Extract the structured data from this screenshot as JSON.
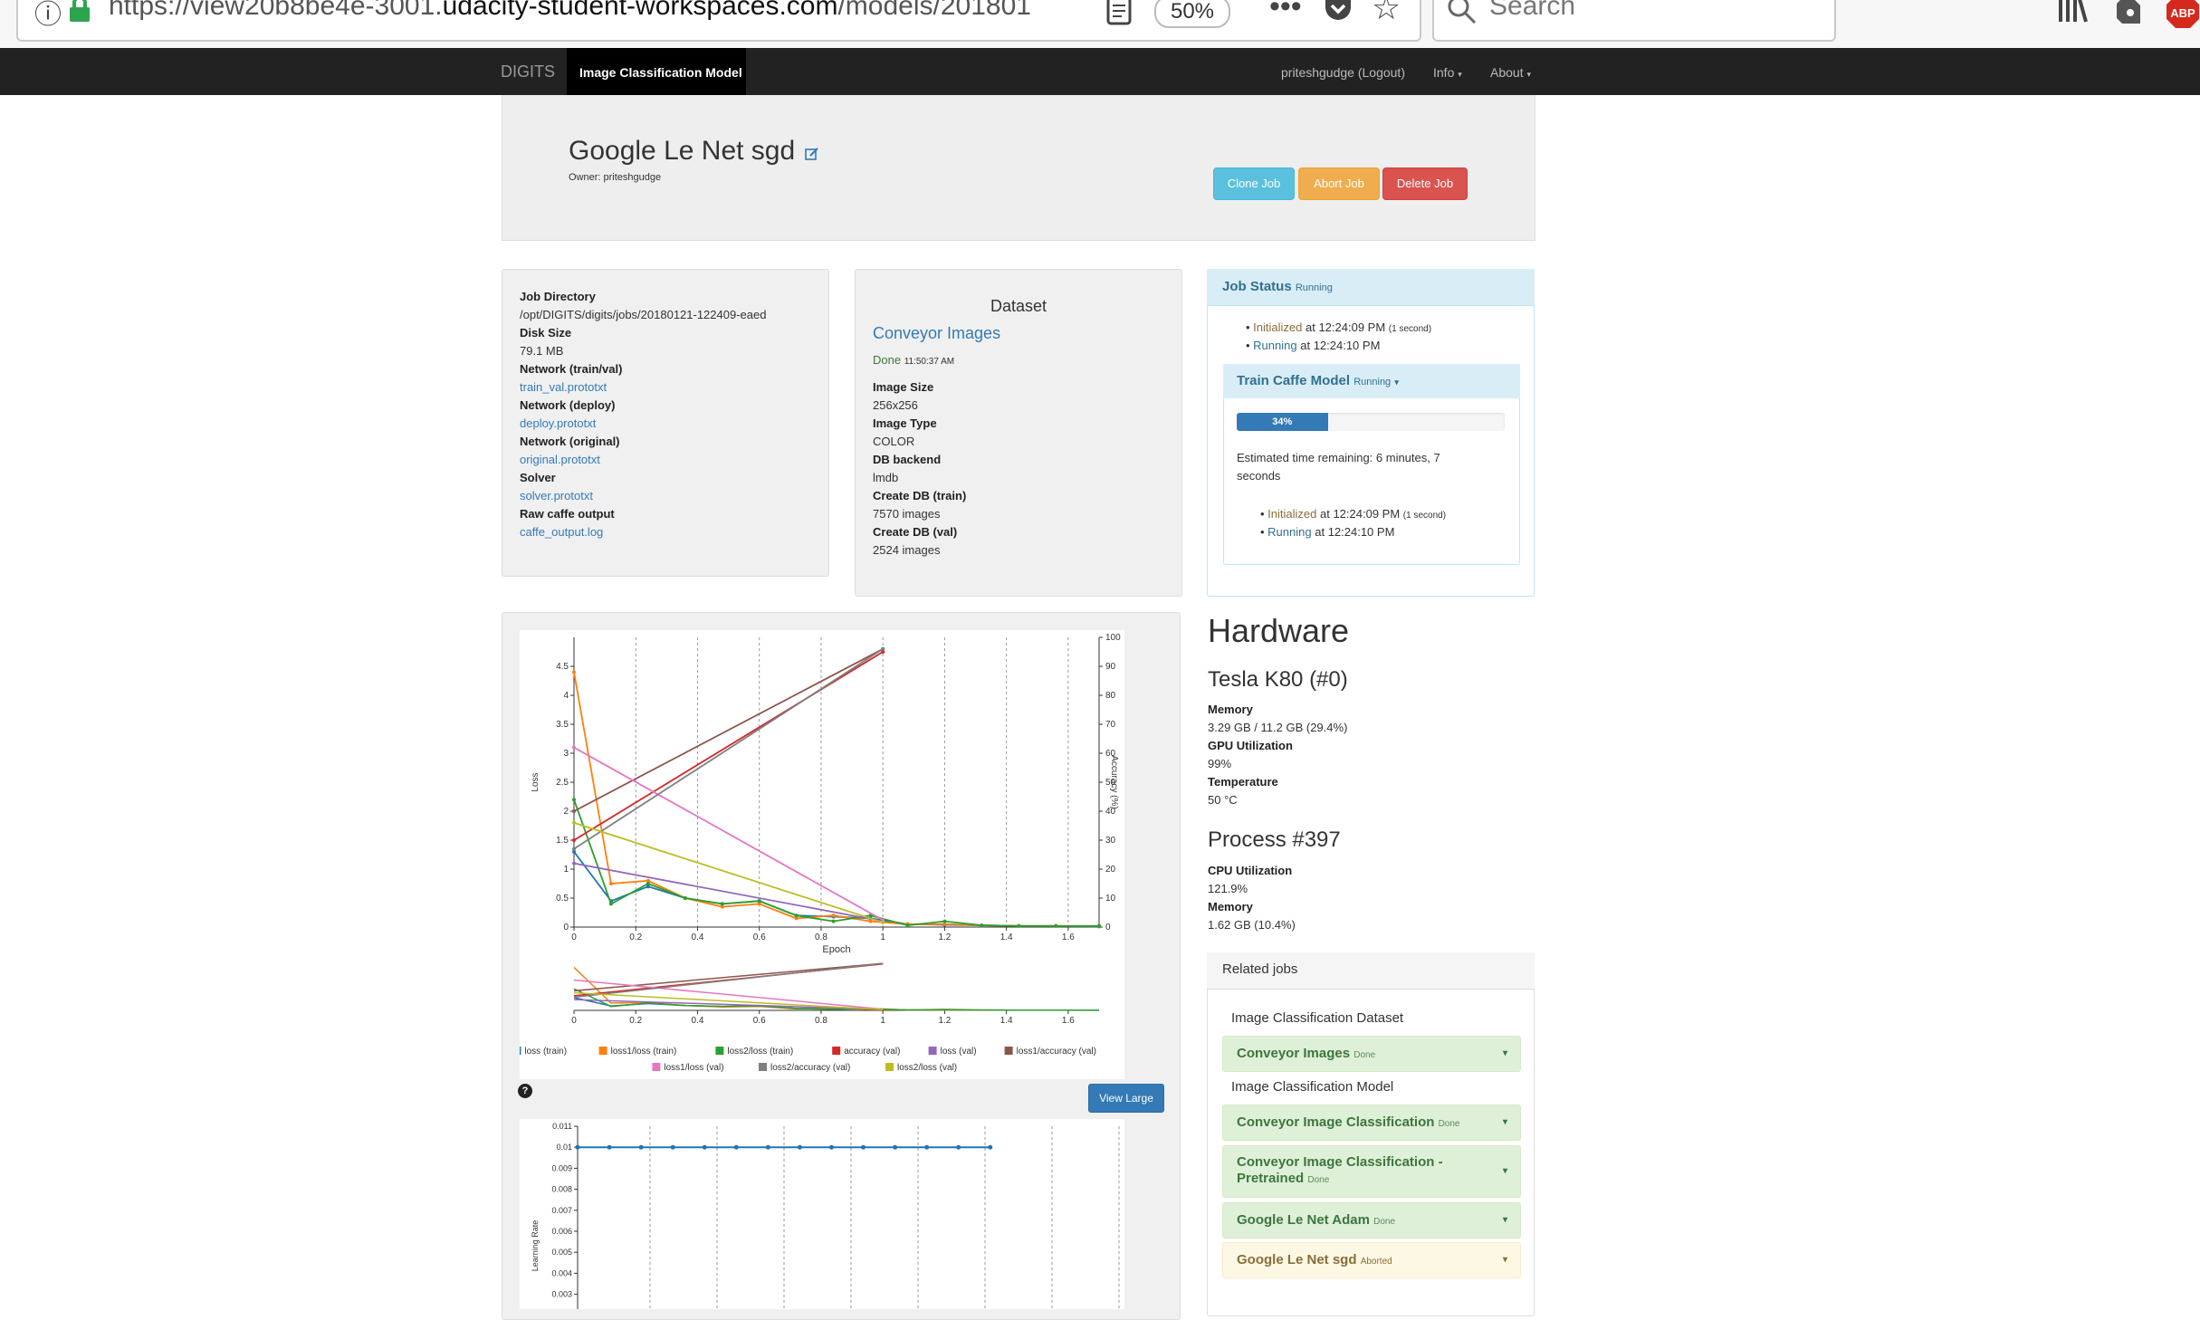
{
  "browser": {
    "url_prefix": "https://view20b8be4e-3001.",
    "url_domain": "udacity-student-workspaces.com",
    "url_suffix": "/models/201801",
    "zoom": "50%",
    "search_placeholder": "Search",
    "more": "•••",
    "abp": "ABP"
  },
  "navbar": {
    "brand": "DIGITS",
    "active_tab": "Image Classification Model",
    "user": "priteshgudge (Logout)",
    "info": "Info",
    "about": "About"
  },
  "header": {
    "title": "Google Le Net sgd",
    "owner": "Owner: priteshgudge",
    "clone_btn": "Clone Job",
    "abort_btn": "Abort Job",
    "delete_btn": "Delete Job"
  },
  "job_info": {
    "job_dir_label": "Job Directory",
    "job_dir": "/opt/DIGITS/digits/jobs/20180121-122409-eaed",
    "disk_label": "Disk Size",
    "disk": "79.1 MB",
    "net_trainval_label": "Network (train/val)",
    "net_trainval": "train_val.prototxt",
    "net_deploy_label": "Network (deploy)",
    "net_deploy": "deploy.prototxt",
    "net_orig_label": "Network (original)",
    "net_orig": "original.prototxt",
    "solver_label": "Solver",
    "solver": "solver.prototxt",
    "raw_label": "Raw caffe output",
    "raw": "caffe_output.log"
  },
  "dataset": {
    "heading": "Dataset",
    "name": "Conveyor Images",
    "status": "Done",
    "status_time": "11:50:37 AM",
    "image_size_label": "Image Size",
    "image_size": "256x256",
    "image_type_label": "Image Type",
    "image_type": "COLOR",
    "db_backend_label": "DB backend",
    "db_backend": "lmdb",
    "create_train_label": "Create DB (train)",
    "create_train": "7570 images",
    "create_val_label": "Create DB (val)",
    "create_val": "2524 images"
  },
  "job_status": {
    "title": "Job Status",
    "state": "Running",
    "init_label": "Initialized",
    "init_time": "at 12:24:09 PM",
    "init_dur": "(1 second)",
    "run_label": "Running",
    "run_time": "at 12:24:10 PM",
    "train_title": "Train Caffe Model",
    "train_state": "Running",
    "progress": 34,
    "progress_label": "34%",
    "eta_line1": "Estimated time remaining: 6 minutes, 7",
    "eta_line2": "seconds"
  },
  "hardware": {
    "title": "Hardware",
    "gpu": "Tesla K80 (#0)",
    "mem_label": "Memory",
    "mem": "3.29 GB / 11.2 GB (29.4%)",
    "gpu_util_label": "GPU Utilization",
    "gpu_util": "99%",
    "temp_label": "Temperature",
    "temp": "50 °C",
    "process": "Process #397",
    "cpu_label": "CPU Utilization",
    "cpu": "121.9%",
    "pmem_label": "Memory",
    "pmem": "1.62 GB (10.4%)"
  },
  "related": {
    "title": "Related jobs",
    "ds_heading": "Image Classification Dataset",
    "ds_item": "Conveyor Images",
    "ds_item_state": "Done",
    "model_heading": "Image Classification Model",
    "items": [
      {
        "name": "Conveyor Image Classification",
        "state": "Done"
      },
      {
        "name": "Conveyor Image Classification - Pretrained",
        "state": "Done"
      },
      {
        "name": "Google Le Net Adam",
        "state": "Done"
      },
      {
        "name": "Google Le Net sgd",
        "state": "Aborted"
      }
    ]
  },
  "chart_controls": {
    "view_large": "View Large",
    "help": "?"
  },
  "chart_data": [
    {
      "type": "line",
      "xlabel": "Epoch",
      "ylabel": "Loss",
      "y2label": "Accuracy (%)",
      "xlim": [
        0,
        1.7
      ],
      "ylim": [
        0,
        5
      ],
      "y2lim": [
        0,
        100
      ],
      "xticks": [
        "0",
        "0.2",
        "0.4",
        "0.6",
        "0.8",
        "1",
        "1.2",
        "1.4",
        "1.6"
      ],
      "yticks": [
        "0",
        "0.5",
        "1",
        "1.5",
        "2",
        "2.5",
        "3",
        "3.5",
        "4",
        "4.5"
      ],
      "y2ticks": [
        "0",
        "10",
        "20",
        "30",
        "40",
        "50",
        "60",
        "70",
        "80",
        "90",
        "100"
      ],
      "series": [
        {
          "name": "loss (train)",
          "color": "#1f77b4",
          "axis": "left",
          "x": [
            0,
            0.12,
            0.24,
            0.36,
            0.48,
            0.6,
            0.72,
            0.84,
            0.96,
            1.08,
            1.2,
            1.32,
            1.44,
            1.56,
            1.7
          ],
          "y": [
            1.3,
            0.45,
            0.7,
            0.5,
            0.4,
            0.45,
            0.2,
            0.18,
            0.15,
            0.05,
            0.04,
            0.03,
            0.02,
            0.02,
            0.01
          ]
        },
        {
          "name": "loss1/loss (train)",
          "color": "#ff7f0e",
          "axis": "left",
          "x": [
            0,
            0.12,
            0.24,
            0.36,
            0.48,
            0.6,
            0.72,
            0.84,
            0.96,
            1.08,
            1.2,
            1.32,
            1.44,
            1.56,
            1.7
          ],
          "y": [
            4.4,
            0.75,
            0.8,
            0.5,
            0.35,
            0.4,
            0.15,
            0.2,
            0.1,
            0.05,
            0.05,
            0.03,
            0.02,
            0.02,
            0.02
          ]
        },
        {
          "name": "loss2/loss (train)",
          "color": "#2ca02c",
          "axis": "left",
          "x": [
            0,
            0.12,
            0.24,
            0.36,
            0.48,
            0.6,
            0.72,
            0.84,
            0.96,
            1.08,
            1.2,
            1.32,
            1.44,
            1.56,
            1.7
          ],
          "y": [
            2.2,
            0.4,
            0.75,
            0.5,
            0.4,
            0.45,
            0.2,
            0.1,
            0.2,
            0.03,
            0.1,
            0.03,
            0.02,
            0.02,
            0.02
          ]
        },
        {
          "name": "accuracy (val)",
          "color": "#d62728",
          "axis": "right",
          "x": [
            0,
            1
          ],
          "y": [
            30,
            95
          ]
        },
        {
          "name": "loss (val)",
          "color": "#9467bd",
          "axis": "left",
          "x": [
            0,
            1
          ],
          "y": [
            1.1,
            0.1
          ]
        },
        {
          "name": "loss1/accuracy (val)",
          "color": "#8c564b",
          "axis": "right",
          "x": [
            0,
            1
          ],
          "y": [
            40,
            96
          ]
        },
        {
          "name": "loss1/loss (val)",
          "color": "#e377c2",
          "axis": "left",
          "x": [
            0,
            1
          ],
          "y": [
            3.1,
            0.12
          ]
        },
        {
          "name": "loss2/accuracy (val)",
          "color": "#7f7f7f",
          "axis": "right",
          "x": [
            0,
            1
          ],
          "y": [
            27,
            96
          ]
        },
        {
          "name": "loss2/loss (val)",
          "color": "#bcbd22",
          "axis": "left",
          "x": [
            0,
            1
          ],
          "y": [
            1.8,
            0.08
          ]
        }
      ]
    },
    {
      "type": "line",
      "ylabel": "Learning Rate",
      "xlim": [
        0,
        1.7
      ],
      "ylim": [
        0.003,
        0.011
      ],
      "yticks": [
        "0.003",
        "0.004",
        "0.005",
        "0.006",
        "0.007",
        "0.008",
        "0.009",
        "0.01",
        "0.011"
      ],
      "series": [
        {
          "name": "",
          "color": "#1f77b4",
          "x": [
            0,
            0.1,
            0.2,
            0.3,
            0.4,
            0.5,
            0.6,
            0.7,
            0.8,
            0.9,
            1.0,
            1.1,
            1.2,
            1.3
          ],
          "y": [
            0.01,
            0.01,
            0.01,
            0.01,
            0.01,
            0.01,
            0.01,
            0.01,
            0.01,
            0.01,
            0.01,
            0.01,
            0.01,
            0.01
          ]
        }
      ]
    }
  ]
}
